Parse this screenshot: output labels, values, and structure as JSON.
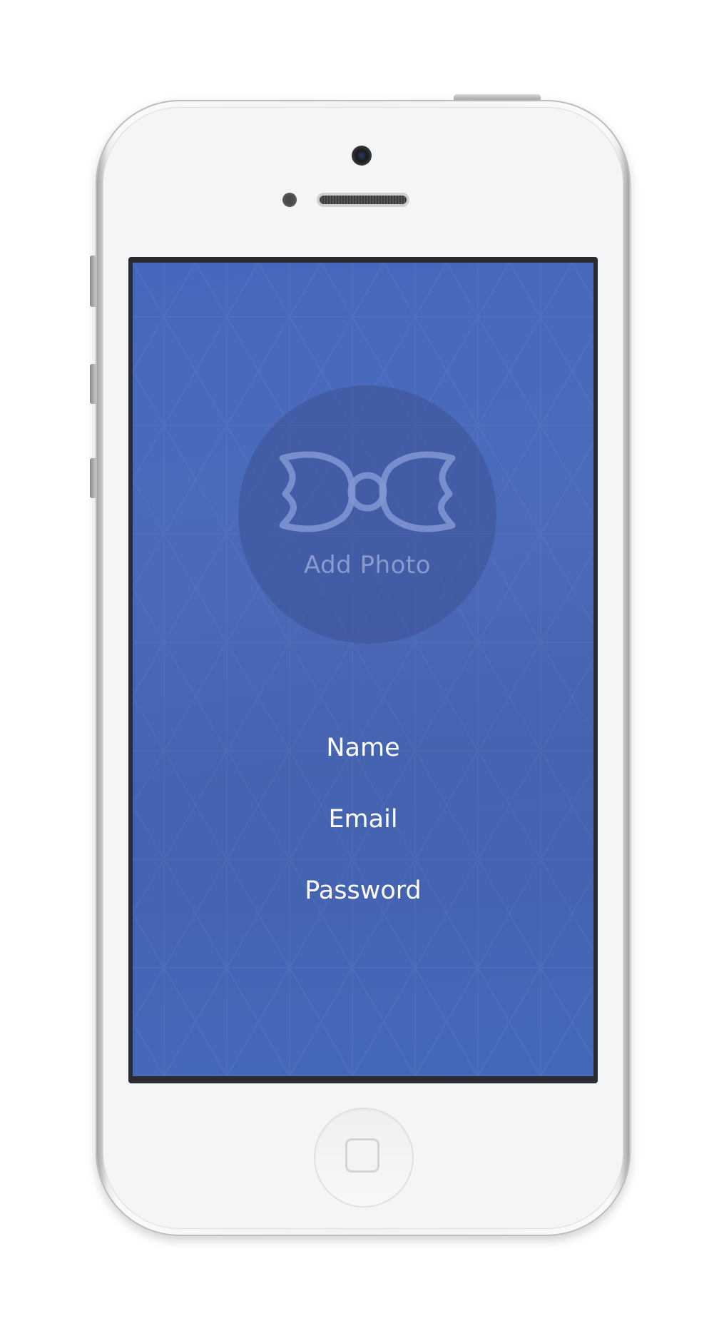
{
  "signup": {
    "add_photo_label": "Add Photo",
    "fields": {
      "name_label": "Name",
      "email_label": "Email",
      "password_label": "Password"
    }
  },
  "colors": {
    "screen_background": "#4568bc",
    "field_text": "#ffffff",
    "photo_circle": "#3c5296",
    "device_body": "#f4f5f7"
  },
  "icons": {
    "photo_placeholder": "bowtie-icon",
    "home": "home-button-icon"
  }
}
